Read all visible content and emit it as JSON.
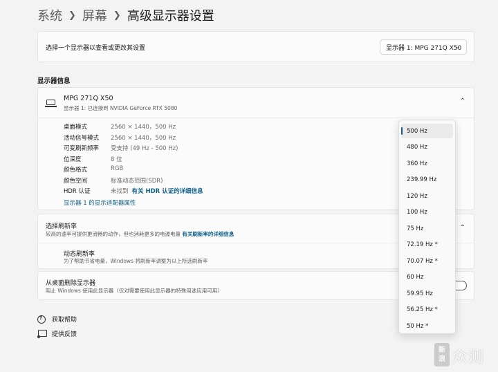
{
  "breadcrumb": {
    "items": [
      "系统",
      "屏幕",
      "高级显示器设置"
    ]
  },
  "display_select": {
    "label": "选择一个显示器以查看或更改其设置",
    "value": "显示器 1: MPG 271Q X50"
  },
  "section_title": "显示器信息",
  "display_info": {
    "name": "MPG 271Q X50",
    "subtitle": "显示器 1: 已连接到 NVIDIA GeForce RTX 5080",
    "properties": [
      {
        "label": "桌面模式",
        "value": "2560 × 1440，500 Hz"
      },
      {
        "label": "活动信号模式",
        "value": "2560 × 1440，500 Hz"
      },
      {
        "label": "可变刷新频率",
        "value": "受支持 (49 Hz - 500 Hz)"
      },
      {
        "label": "位深度",
        "value": "8 位"
      },
      {
        "label": "颜色格式",
        "value": "RGB"
      },
      {
        "label": "颜色空间",
        "value": "标准动态范围(SDR)"
      },
      {
        "label": "HDR 认证",
        "value": "未找到",
        "link": "有关 HDR 认证的详细信息"
      }
    ],
    "adapter_link": "显示器 1 的显示适配器属性"
  },
  "refresh_rate": {
    "title": "选择刷新率",
    "description": "较高的速率可提供更流畅的动作，但也消耗更多的电源电量",
    "link": "有关刷新率的详细信息",
    "dynamic_title": "动态刷新率",
    "dynamic_desc": "为了帮助节省电量，Windows 将刷新率调整为以上所选刷新率"
  },
  "remove_display": {
    "title": "从桌面删除显示器",
    "description": "阻止 Windows 使用此显示器（仅对需要使用此显示器的特殊用途应用可用）"
  },
  "links": {
    "help": "获取帮助",
    "feedback": "提供反馈"
  },
  "refresh_options": [
    "500 Hz",
    "480 Hz",
    "360 Hz",
    "239.99 Hz",
    "120 Hz",
    "100 Hz",
    "75 Hz",
    "72.19 Hz *",
    "70.07 Hz *",
    "60 Hz",
    "59.95 Hz",
    "56.25 Hz *",
    "50 Hz *"
  ],
  "selected_refresh": "500 Hz",
  "watermark": {
    "badge": [
      "新",
      "浪"
    ],
    "text": "众测"
  },
  "colors": {
    "accent": "#0f5f8a",
    "background": "#f3f3f3",
    "card": "#fbfbfb"
  }
}
